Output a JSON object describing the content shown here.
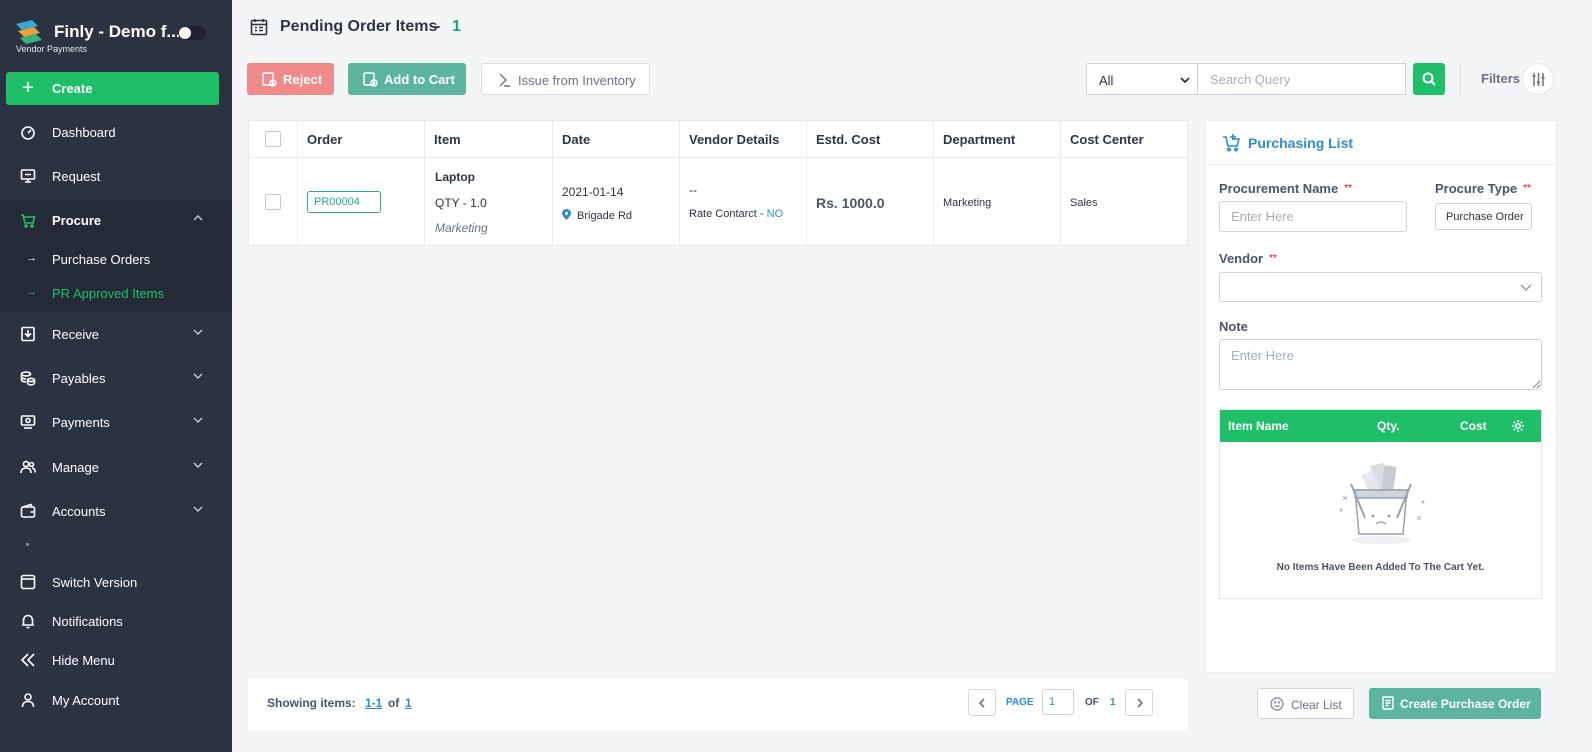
{
  "app": {
    "title": "Finly - Demo f...",
    "subtitle": "Vendor Payments"
  },
  "sidebar": {
    "create_label": "Create",
    "items": [
      {
        "label": "Dashboard",
        "icon": "dashboard-icon"
      },
      {
        "label": "Request",
        "icon": "request-icon"
      },
      {
        "label": "Procure",
        "icon": "cart-icon",
        "expanded": true
      },
      {
        "label": "Receive",
        "icon": "receive-icon"
      },
      {
        "label": "Payables",
        "icon": "coins-icon"
      },
      {
        "label": "Payments",
        "icon": "payments-icon"
      },
      {
        "label": "Manage",
        "icon": "users-icon"
      },
      {
        "label": "Accounts",
        "icon": "wallet-icon"
      }
    ],
    "procure_sub": [
      {
        "label": "Purchase Orders"
      },
      {
        "label": "PR Approved Items",
        "current": true
      }
    ],
    "bottom": [
      {
        "label": "Switch Version",
        "icon": "switch-icon"
      },
      {
        "label": "Notifications",
        "icon": "bell-icon"
      },
      {
        "label": "Hide Menu",
        "icon": "double-chevron-left-icon"
      },
      {
        "label": "My Account",
        "icon": "user-icon"
      }
    ]
  },
  "header": {
    "title": "Pending Order Items",
    "dash": "-",
    "count": "1"
  },
  "toolbar": {
    "reject_label": "Reject",
    "add_to_cart_label": "Add to Cart",
    "issue_label": "Issue from Inventory",
    "filter_value": "All",
    "search_placeholder": "Search Query",
    "filters_label": "Filters"
  },
  "table": {
    "columns": [
      "Order",
      "Item",
      "Date",
      "Vendor Details",
      "Estd. Cost",
      "Department",
      "Cost Center"
    ],
    "rows": [
      {
        "order": "PR00004",
        "item_name": "Laptop",
        "item_qty": "QTY - 1.0",
        "item_dept": "Marketing",
        "date": "2021-01-14",
        "location": "Brigade Rd",
        "vendor_dash": "--",
        "rate_contract_label": "Rate Contarct -",
        "rate_contract_value": "NO",
        "cost": "Rs. 1000.0",
        "department": "Marketing",
        "cost_center": "Sales"
      }
    ]
  },
  "pager": {
    "showing_label": "Showing items:",
    "range": "1-1",
    "of_label": "of",
    "total": "1",
    "page_label": "PAGE",
    "page_value": "1",
    "of_pages_label": "OF",
    "total_pages": "1"
  },
  "panel": {
    "title": "Purchasing List",
    "procurement_name_label": "Procurement Name",
    "procurement_name_placeholder": "Enter Here",
    "procure_type_label": "Procure Type",
    "procure_type_value": "Purchase Order",
    "required_mark": "**",
    "vendor_label": "Vendor",
    "note_label": "Note",
    "note_placeholder": "Enter Here",
    "cart_columns": [
      "Item Name",
      "Qty.",
      "Cost"
    ],
    "empty_text": "No Items Have Been Added To The Cart Yet.",
    "clear_label": "Clear List",
    "create_po_label": "Create Purchase Order"
  },
  "colors": {
    "sidebar_bg": "#2b3240",
    "accent_green": "#1fbf6a",
    "teal": "#5cb49c",
    "reject_red": "#ef8a8a",
    "link_blue": "#2d8bd6"
  }
}
